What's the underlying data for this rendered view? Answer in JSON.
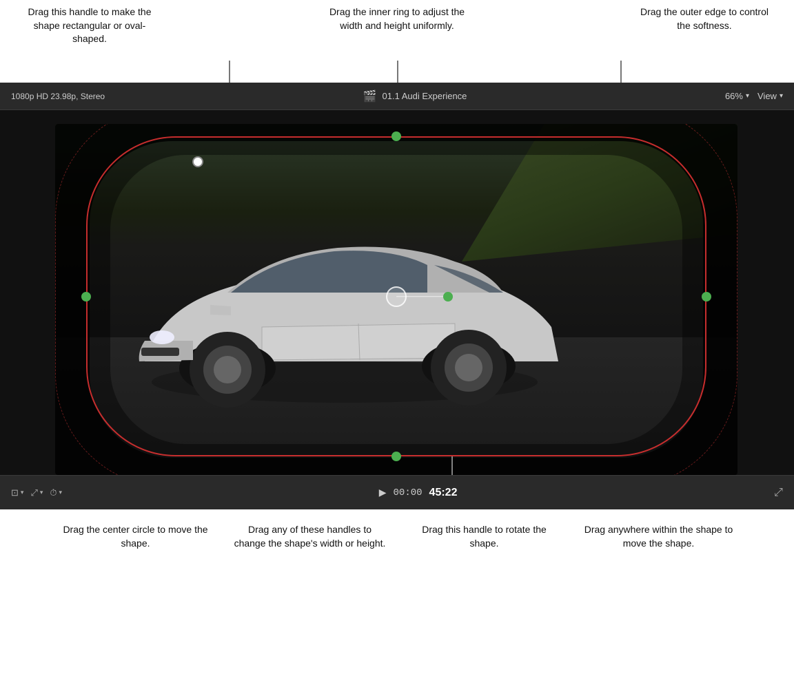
{
  "annotations": {
    "top_left": {
      "text": "Drag this handle to make the shape rectangular or oval-shaped."
    },
    "top_center": {
      "text": "Drag the inner ring to adjust the width and height uniformly."
    },
    "top_right": {
      "text": "Drag the outer edge to control the softness."
    },
    "bottom_left": {
      "text": "Drag the center circle to move the shape."
    },
    "bottom_center_left": {
      "text": "Drag any of these handles to change the shape's width or height."
    },
    "bottom_center_right": {
      "text": "Drag this handle to rotate the shape."
    },
    "bottom_right": {
      "text": "Drag anywhere within the shape to move the shape."
    }
  },
  "player": {
    "format": "1080p HD 23.98p, Stereo",
    "title": "01.1 Audi Experience",
    "zoom": "66%",
    "view_label": "View",
    "zoom_label": "66%",
    "timecode_prefix": "00:00",
    "timecode_bold": "45:22",
    "play_icon": "▶"
  },
  "controls": {
    "crop_icon": "⊡",
    "transform_icon": "⤢",
    "speed_icon": "⏱",
    "fullscreen_icon": "⤡"
  },
  "colors": {
    "accent_green": "#4caf50",
    "mask_border": "#dc3232",
    "background": "#000000",
    "topbar": "#2a2a2a"
  }
}
